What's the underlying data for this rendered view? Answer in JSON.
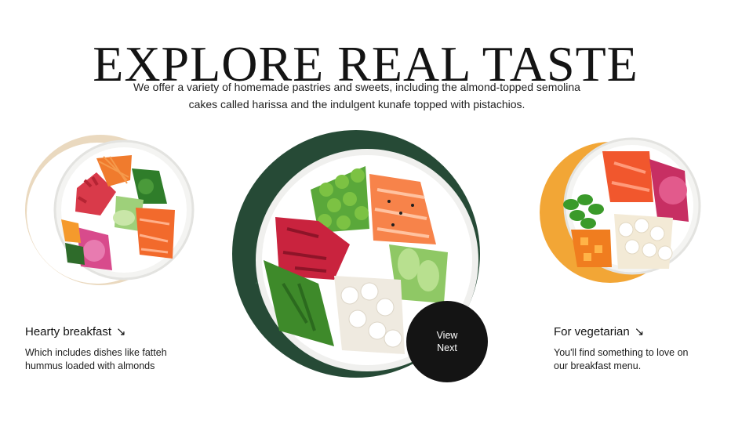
{
  "hero": {
    "title": "EXPLORE REAL TASTE",
    "description": "We offer a variety of homemade pastries and sweets, including the almond-topped semolina cakes called harissa and the indulgent kunafe topped with pistachios."
  },
  "cards": [
    {
      "title": "Hearty breakfast",
      "arrow": "↘",
      "text": "Which includes dishes like fatteh hummus loaded with almonds"
    },
    {
      "title": "For vegetarian",
      "arrow": "↘",
      "text": "You'll find something to love on our breakfast menu."
    }
  ],
  "view_next": {
    "line1": "View",
    "line2": "Next"
  },
  "colors": {
    "accent_green": "#264a36",
    "accent_tan": "#d9b98a",
    "accent_orange": "#f2a636",
    "button_black": "#141414"
  },
  "icons": {
    "card_arrow": "arrow-down-right-icon"
  }
}
